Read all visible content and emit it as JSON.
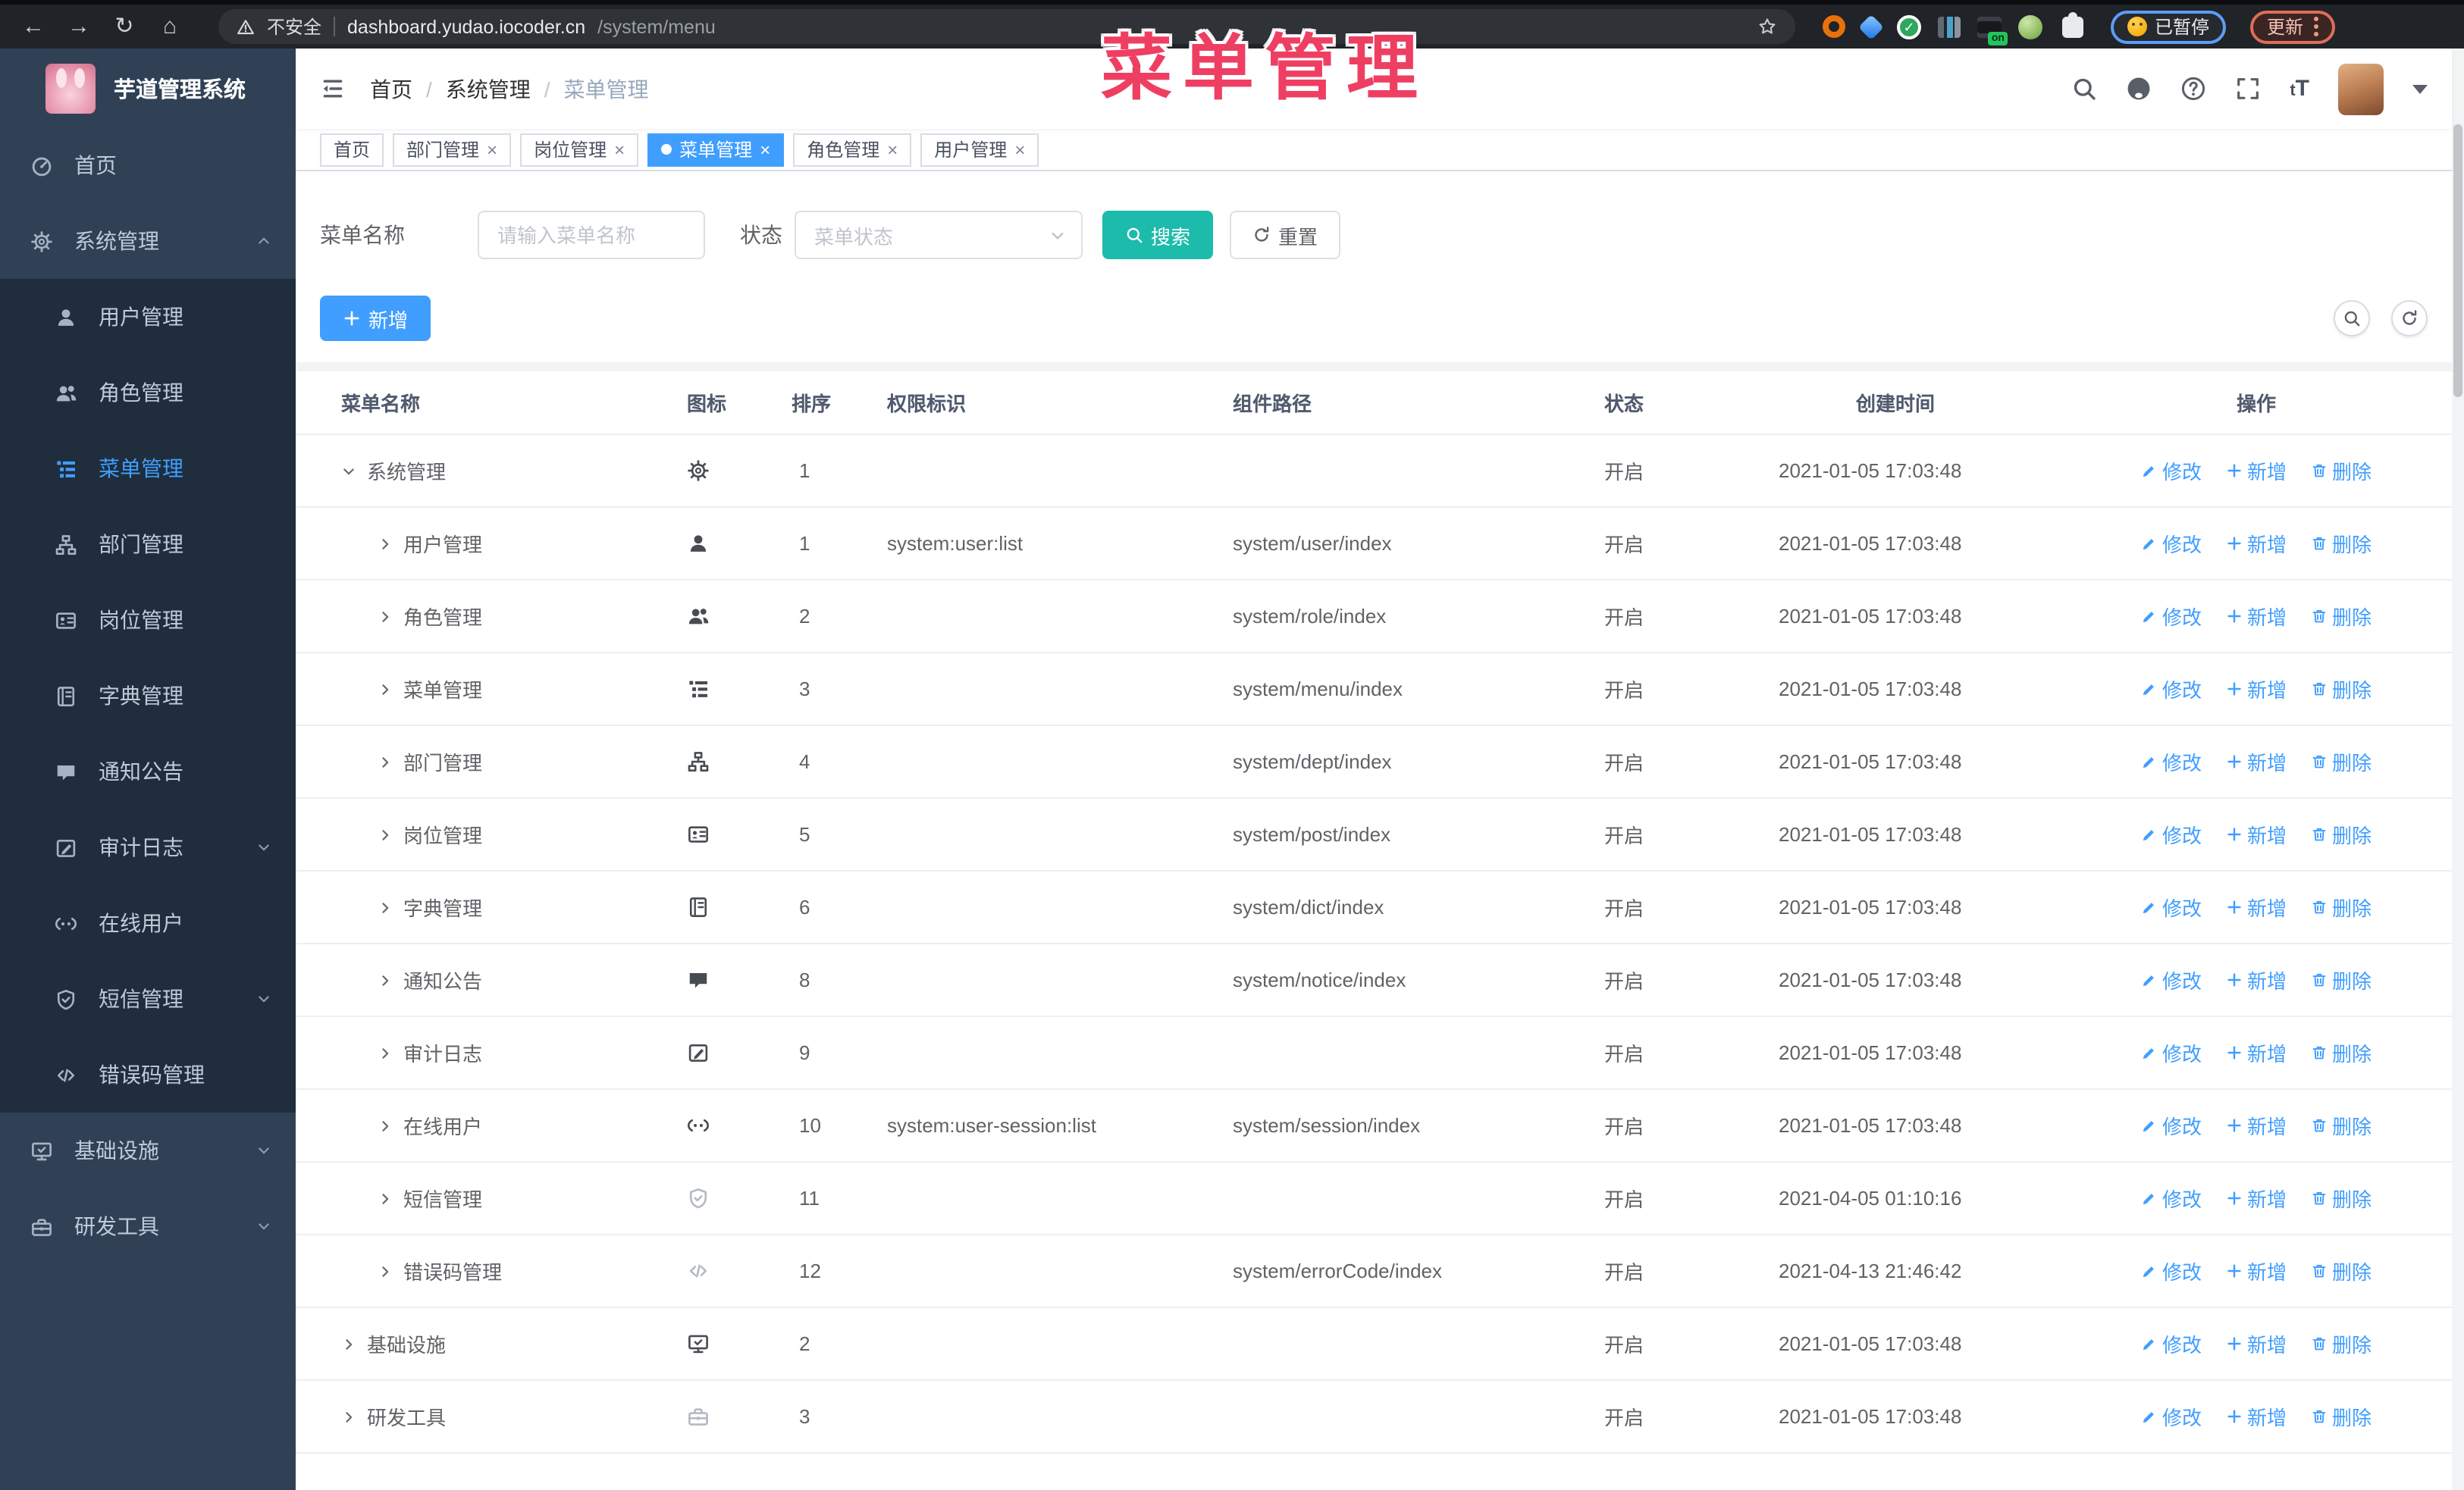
{
  "colors": {
    "accent": "#409eff",
    "search_button": "#1cbbab",
    "annotation": "#ee3f63",
    "sidebar_bg": "#304156",
    "submenu_bg": "#1f2d3d"
  },
  "browser": {
    "insecure_label": "不安全",
    "url_host": "dashboard.yudao.iocoder.cn",
    "url_path": "/system/menu",
    "extensions": [
      "orange-ring",
      "blue-gem",
      "green-shield",
      "teal-columns",
      "on-badge",
      "green-monkey",
      "puzzle"
    ],
    "paused_label": "已暂停",
    "update_label": "更新"
  },
  "annotation": {
    "text": "菜单管理"
  },
  "sidebar": {
    "title": "芋道管理系统",
    "items": [
      {
        "label": "首页",
        "icon": "gauge-icon",
        "level": "top"
      },
      {
        "label": "系统管理",
        "icon": "gear-icon",
        "level": "top",
        "chevron": "up"
      },
      {
        "label": "用户管理",
        "icon": "user-icon",
        "level": "sub"
      },
      {
        "label": "角色管理",
        "icon": "users-icon",
        "level": "sub"
      },
      {
        "label": "菜单管理",
        "icon": "treetable-icon",
        "level": "sub",
        "active": true
      },
      {
        "label": "部门管理",
        "icon": "orgtree-icon",
        "level": "sub"
      },
      {
        "label": "岗位管理",
        "icon": "idcard-icon",
        "level": "sub"
      },
      {
        "label": "字典管理",
        "icon": "book-icon",
        "level": "sub"
      },
      {
        "label": "通知公告",
        "icon": "comment-icon",
        "level": "sub"
      },
      {
        "label": "审计日志",
        "icon": "editlog-icon",
        "level": "sub",
        "chevron": "down"
      },
      {
        "label": "在线用户",
        "icon": "online-icon",
        "level": "sub"
      },
      {
        "label": "短信管理",
        "icon": "shield-icon",
        "level": "sub",
        "chevron": "down"
      },
      {
        "label": "错误码管理",
        "icon": "code-icon",
        "level": "sub"
      },
      {
        "label": "基础设施",
        "icon": "monitor-icon",
        "level": "top",
        "chevron": "down"
      },
      {
        "label": "研发工具",
        "icon": "toolbox-icon",
        "level": "top",
        "chevron": "down"
      }
    ]
  },
  "header": {
    "breadcrumb": [
      "首页",
      "系统管理",
      "菜单管理"
    ]
  },
  "tags": {
    "items": [
      {
        "label": "首页"
      },
      {
        "label": "部门管理",
        "closable": true
      },
      {
        "label": "岗位管理",
        "closable": true
      },
      {
        "label": "菜单管理",
        "closable": true,
        "active": true
      },
      {
        "label": "角色管理",
        "closable": true
      },
      {
        "label": "用户管理",
        "closable": true
      }
    ]
  },
  "search": {
    "name_label": "菜单名称",
    "name_placeholder": "请输入菜单名称",
    "status_label": "状态",
    "status_placeholder": "菜单状态",
    "search_label": "搜索",
    "reset_label": "重置"
  },
  "toolbar": {
    "add_label": "新增"
  },
  "table": {
    "columns": [
      "菜单名称",
      "图标",
      "排序",
      "权限标识",
      "组件路径",
      "状态",
      "创建时间",
      "操作"
    ],
    "action_labels": [
      "修改",
      "新增",
      "删除"
    ],
    "rows": [
      {
        "name": "系统管理",
        "level": 0,
        "expanded": true,
        "icon": "gear-icon",
        "sort": "1",
        "permission": "",
        "path": "",
        "status": "开启",
        "created": "2021-01-05 17:03:48"
      },
      {
        "name": "用户管理",
        "level": 1,
        "icon": "user-icon",
        "sort": "1",
        "permission": "system:user:list",
        "path": "system/user/index",
        "status": "开启",
        "created": "2021-01-05 17:03:48"
      },
      {
        "name": "角色管理",
        "level": 1,
        "icon": "users-icon",
        "sort": "2",
        "permission": "",
        "path": "system/role/index",
        "status": "开启",
        "created": "2021-01-05 17:03:48"
      },
      {
        "name": "菜单管理",
        "level": 1,
        "icon": "treetable-icon",
        "sort": "3",
        "permission": "",
        "path": "system/menu/index",
        "status": "开启",
        "created": "2021-01-05 17:03:48"
      },
      {
        "name": "部门管理",
        "level": 1,
        "icon": "orgtree-icon",
        "sort": "4",
        "permission": "",
        "path": "system/dept/index",
        "status": "开启",
        "created": "2021-01-05 17:03:48"
      },
      {
        "name": "岗位管理",
        "level": 1,
        "icon": "idcard-icon",
        "sort": "5",
        "permission": "",
        "path": "system/post/index",
        "status": "开启",
        "created": "2021-01-05 17:03:48"
      },
      {
        "name": "字典管理",
        "level": 1,
        "icon": "book-icon",
        "sort": "6",
        "permission": "",
        "path": "system/dict/index",
        "status": "开启",
        "created": "2021-01-05 17:03:48"
      },
      {
        "name": "通知公告",
        "level": 1,
        "icon": "comment-icon",
        "sort": "8",
        "permission": "",
        "path": "system/notice/index",
        "status": "开启",
        "created": "2021-01-05 17:03:48"
      },
      {
        "name": "审计日志",
        "level": 1,
        "icon": "editlog-icon",
        "sort": "9",
        "permission": "",
        "path": "",
        "status": "开启",
        "created": "2021-01-05 17:03:48"
      },
      {
        "name": "在线用户",
        "level": 1,
        "icon": "online-icon",
        "sort": "10",
        "permission": "system:user-session:list",
        "path": "system/session/index",
        "status": "开启",
        "created": "2021-01-05 17:03:48"
      },
      {
        "name": "短信管理",
        "level": 1,
        "icon": "shield-icon",
        "icon_light": true,
        "sort": "11",
        "permission": "",
        "path": "",
        "status": "开启",
        "created": "2021-04-05 01:10:16"
      },
      {
        "name": "错误码管理",
        "level": 1,
        "icon": "code-icon",
        "icon_light": true,
        "sort": "12",
        "permission": "",
        "path": "system/errorCode/index",
        "status": "开启",
        "created": "2021-04-13 21:46:42"
      },
      {
        "name": "基础设施",
        "level": 0,
        "icon": "monitor-icon",
        "sort": "2",
        "permission": "",
        "path": "",
        "status": "开启",
        "created": "2021-01-05 17:03:48"
      },
      {
        "name": "研发工具",
        "level": 0,
        "icon": "toolbox-icon",
        "icon_light": true,
        "sort": "3",
        "permission": "",
        "path": "",
        "status": "开启",
        "created": "2021-01-05 17:03:48"
      }
    ]
  }
}
